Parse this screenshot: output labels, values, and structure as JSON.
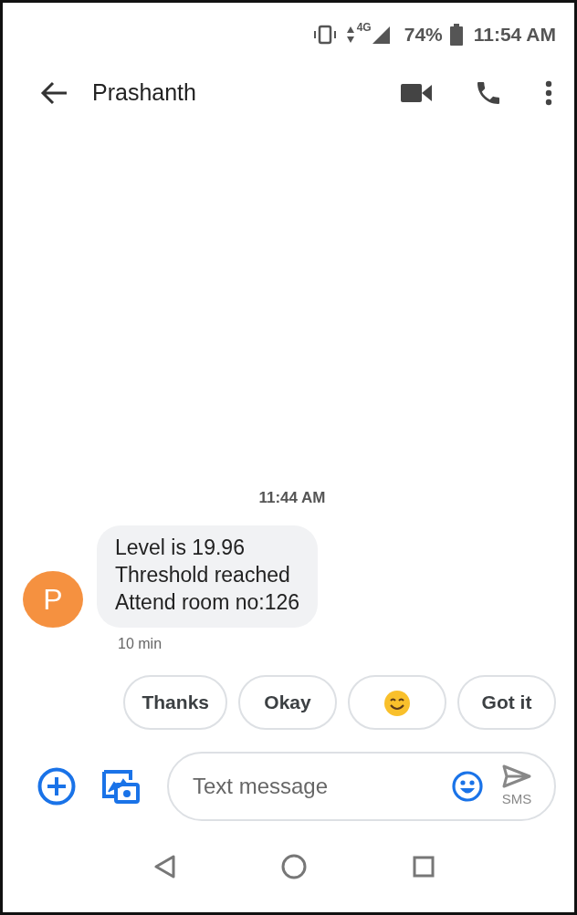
{
  "status_bar": {
    "network": "4G",
    "battery": "74%",
    "time": "11:54 AM"
  },
  "header": {
    "title": "Prashanth"
  },
  "conversation": {
    "timestamp": "11:44 AM",
    "messages": [
      {
        "avatar_letter": "P",
        "color": "#f59140",
        "text": "Level is 19.96\nThreshold reached\nAttend room no:126",
        "age": "10 min"
      }
    ]
  },
  "suggestions": [
    {
      "kind": "text",
      "label": "Thanks"
    },
    {
      "kind": "text",
      "label": "Okay"
    },
    {
      "kind": "emoji"
    },
    {
      "kind": "text",
      "label": "Got it"
    }
  ],
  "composer": {
    "placeholder": "Text message",
    "send_label": "SMS"
  }
}
